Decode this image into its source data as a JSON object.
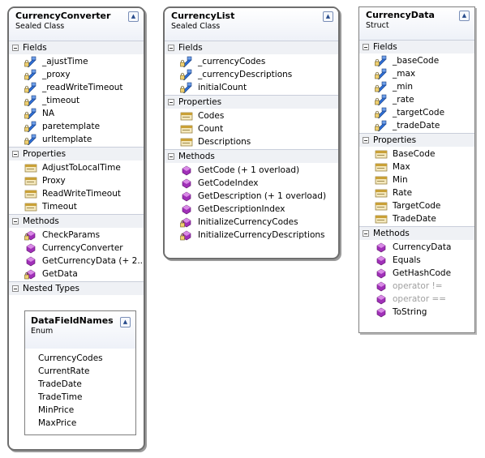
{
  "classes": [
    {
      "title": "CurrencyConverter",
      "kind": "Sealed Class",
      "sections": [
        {
          "name": "Fields",
          "items": [
            {
              "label": "_ajustTime",
              "icon": "private-field-icon"
            },
            {
              "label": "_proxy",
              "icon": "private-field-icon"
            },
            {
              "label": "_readWriteTimeout",
              "icon": "private-field-icon"
            },
            {
              "label": "_timeout",
              "icon": "private-field-icon"
            },
            {
              "label": "NA",
              "icon": "private-field-icon"
            },
            {
              "label": "paretemplate",
              "icon": "private-field-icon"
            },
            {
              "label": "urltemplate",
              "icon": "private-field-icon"
            }
          ]
        },
        {
          "name": "Properties",
          "items": [
            {
              "label": "AdjustToLocalTime",
              "icon": "property-icon"
            },
            {
              "label": "Proxy",
              "icon": "property-icon"
            },
            {
              "label": "ReadWriteTimeout",
              "icon": "property-icon"
            },
            {
              "label": "Timeout",
              "icon": "property-icon"
            }
          ]
        },
        {
          "name": "Methods",
          "items": [
            {
              "label": "CheckParams",
              "icon": "private-method-icon"
            },
            {
              "label": "CurrencyConverter",
              "icon": "method-icon"
            },
            {
              "label": "GetCurrencyData (+ 2...",
              "icon": "method-icon"
            },
            {
              "label": "GetData",
              "icon": "private-method-icon"
            }
          ]
        },
        {
          "name": "Nested Types",
          "items": []
        }
      ]
    },
    {
      "title": "CurrencyList",
      "kind": "Sealed Class",
      "sections": [
        {
          "name": "Fields",
          "items": [
            {
              "label": "_currencyCodes",
              "icon": "private-field-icon"
            },
            {
              "label": "_currencyDescriptions",
              "icon": "private-field-icon"
            },
            {
              "label": "initialCount",
              "icon": "private-field-icon"
            }
          ]
        },
        {
          "name": "Properties",
          "items": [
            {
              "label": "Codes",
              "icon": "property-icon"
            },
            {
              "label": "Count",
              "icon": "property-icon"
            },
            {
              "label": "Descriptions",
              "icon": "property-icon"
            }
          ]
        },
        {
          "name": "Methods",
          "items": [
            {
              "label": "GetCode (+ 1 overload)",
              "icon": "method-icon"
            },
            {
              "label": "GetCodeIndex",
              "icon": "method-icon"
            },
            {
              "label": "GetDescription (+ 1 overload)",
              "icon": "method-icon"
            },
            {
              "label": "GetDescriptionIndex",
              "icon": "method-icon"
            },
            {
              "label": "InitializeCurrencyCodes",
              "icon": "private-method-icon"
            },
            {
              "label": "InitializeCurrencyDescriptions",
              "icon": "private-method-icon"
            }
          ]
        }
      ]
    },
    {
      "title": "CurrencyData",
      "kind": "Struct",
      "sections": [
        {
          "name": "Fields",
          "items": [
            {
              "label": "_baseCode",
              "icon": "private-field-icon"
            },
            {
              "label": "_max",
              "icon": "private-field-icon"
            },
            {
              "label": "_min",
              "icon": "private-field-icon"
            },
            {
              "label": "_rate",
              "icon": "private-field-icon"
            },
            {
              "label": "_targetCode",
              "icon": "private-field-icon"
            },
            {
              "label": "_tradeDate",
              "icon": "private-field-icon"
            }
          ]
        },
        {
          "name": "Properties",
          "items": [
            {
              "label": "BaseCode",
              "icon": "property-icon"
            },
            {
              "label": "Max",
              "icon": "property-icon"
            },
            {
              "label": "Min",
              "icon": "property-icon"
            },
            {
              "label": "Rate",
              "icon": "property-icon"
            },
            {
              "label": "TargetCode",
              "icon": "property-icon"
            },
            {
              "label": "TradeDate",
              "icon": "property-icon"
            }
          ]
        },
        {
          "name": "Methods",
          "items": [
            {
              "label": "CurrencyData",
              "icon": "method-icon"
            },
            {
              "label": "Equals",
              "icon": "method-icon"
            },
            {
              "label": "GetHashCode",
              "icon": "method-icon"
            },
            {
              "label": "operator !=",
              "icon": "method-icon",
              "dim": true
            },
            {
              "label": "operator ==",
              "icon": "method-icon",
              "dim": true
            },
            {
              "label": "ToString",
              "icon": "method-icon"
            }
          ]
        }
      ]
    }
  ],
  "nested_enum": {
    "title": "DataFieldNames",
    "kind": "Enum",
    "members": [
      "CurrencyCodes",
      "CurrentRate",
      "TradeDate",
      "TradeTime",
      "MinPrice",
      "MaxPrice"
    ]
  },
  "colors": {
    "field": "#2f6fd6",
    "method": "#a030b8",
    "property": "#c9a037",
    "header_band": "#eff1f5"
  }
}
